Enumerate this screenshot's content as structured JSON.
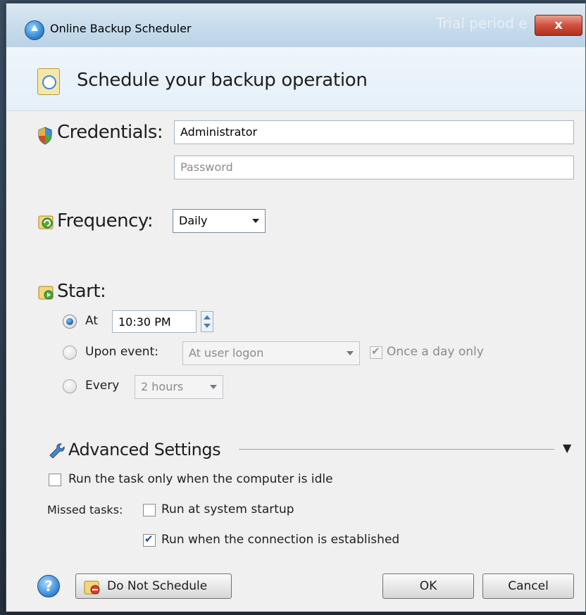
{
  "window": {
    "title": "Online Backup Scheduler",
    "background_title": "Trial period e",
    "close_label": "x"
  },
  "header": {
    "title": "Schedule your backup operation"
  },
  "credentials": {
    "label": "Credentials:",
    "username_value": "Administrator",
    "password_placeholder": "Password"
  },
  "frequency": {
    "label": "Frequency:",
    "selected": "Daily"
  },
  "start": {
    "label": "Start:",
    "at_label": "At",
    "at_time": "10:30 PM",
    "at_checked": true,
    "event_label": "Upon event:",
    "event_selected": "At user logon",
    "once_a_day_label": "Once a day only",
    "once_a_day_checked": true,
    "every_label": "Every",
    "every_selected": "2 hours"
  },
  "advanced": {
    "label": "Advanced Settings",
    "idle_label": "Run the task only when the computer is idle",
    "idle_checked": false,
    "missed_label": "Missed tasks:",
    "startup_label": "Run at system startup",
    "startup_checked": false,
    "connection_label": "Run when the connection is established",
    "connection_checked": true
  },
  "footer": {
    "help_symbol": "?",
    "do_not_schedule_label": "Do Not Schedule",
    "ok_label": "OK",
    "cancel_label": "Cancel"
  },
  "icons": {
    "app": "app-upload-icon",
    "header": "clock-icon",
    "credentials": "shield-icon",
    "frequency": "frequency-icon",
    "start": "start-icon",
    "advanced": "wrench-icon",
    "help": "help-icon",
    "do_not_schedule": "no-schedule-icon"
  },
  "colors": {
    "title_bar": "#c8dcec",
    "close_button": "#d05040",
    "window_bg": "#f0f0f0",
    "accent": "#3a8ad8"
  }
}
